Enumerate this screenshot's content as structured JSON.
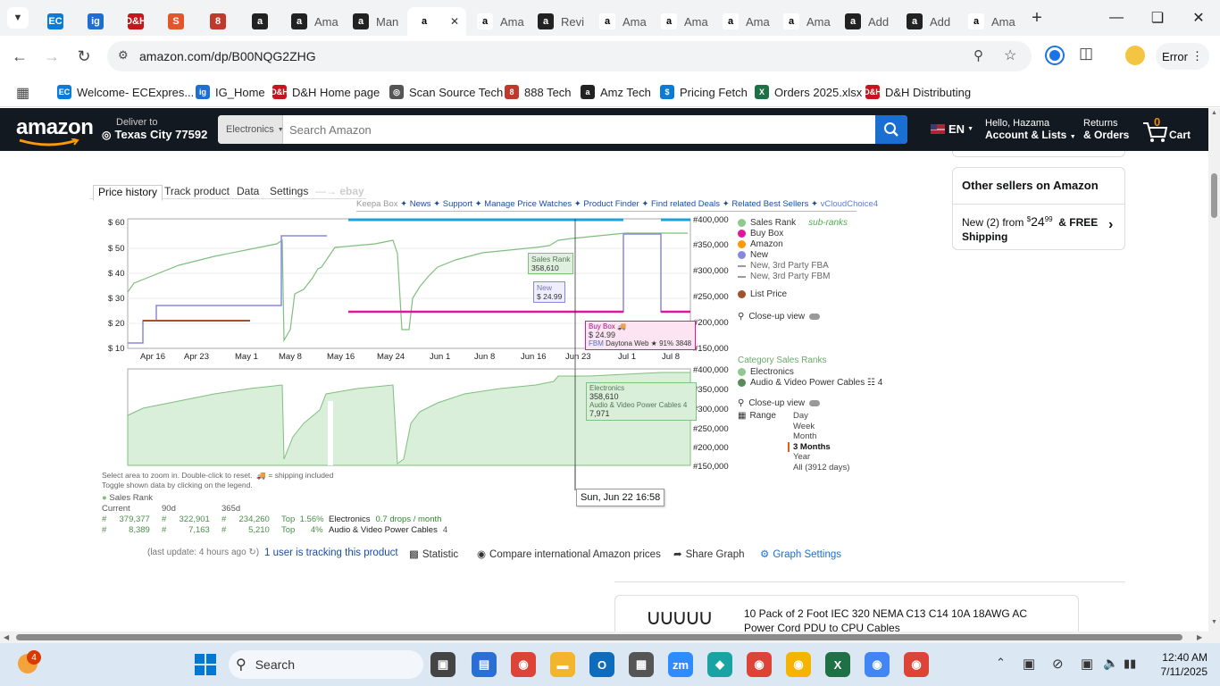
{
  "browser": {
    "tabs": [
      {
        "label": "",
        "icon": "ec-icon",
        "color": "#0a7bd6",
        "glyph": "EC"
      },
      {
        "label": "",
        "icon": "ig-icon",
        "color": "#1f6fd1",
        "glyph": "ig"
      },
      {
        "label": "",
        "icon": "dh-icon",
        "color": "#c4161c",
        "glyph": "D&H"
      },
      {
        "label": "",
        "icon": "scan-icon",
        "color": "#e2562b",
        "glyph": "S"
      },
      {
        "label": "",
        "icon": "888-icon",
        "color": "#c0392b",
        "glyph": "8"
      },
      {
        "label": "",
        "icon": "amz-tech-icon",
        "color": "#222",
        "glyph": "a"
      },
      {
        "label": "Ama",
        "icon": "amz-tech-icon",
        "color": "#222",
        "glyph": "a"
      },
      {
        "label": "Man",
        "icon": "amz-tech-icon",
        "color": "#222",
        "glyph": "a"
      },
      {
        "label": "",
        "icon": "amazon-icon",
        "color": "#ffffff",
        "glyph": "a",
        "active": true
      },
      {
        "label": "Ama",
        "icon": "amazon-icon",
        "color": "#ffffff",
        "glyph": "a"
      },
      {
        "label": "Revi",
        "icon": "amz-tech-icon",
        "color": "#222",
        "glyph": "a"
      },
      {
        "label": "Ama",
        "icon": "amazon-icon",
        "color": "#ffffff",
        "glyph": "a"
      },
      {
        "label": "Ama",
        "icon": "amazon-icon",
        "color": "#ffffff",
        "glyph": "a"
      },
      {
        "label": "Ama",
        "icon": "amazon-icon",
        "color": "#ffffff",
        "glyph": "a"
      },
      {
        "label": "Ama",
        "icon": "amazon-icon",
        "color": "#ffffff",
        "glyph": "a"
      },
      {
        "label": "Add",
        "icon": "amz-tech-icon",
        "color": "#222",
        "glyph": "a"
      },
      {
        "label": "Add",
        "icon": "amz-tech-icon",
        "color": "#222",
        "glyph": "a"
      },
      {
        "label": "Ama",
        "icon": "amazon-icon",
        "color": "#ffffff",
        "glyph": "a"
      }
    ],
    "url": "amazon.com/dp/B00NQG2ZHG",
    "profile_status": "Error",
    "bookmarks": [
      {
        "label": "Welcome- ECExpres...",
        "color": "#0a7bd6",
        "glyph": "EC"
      },
      {
        "label": "IG_Home",
        "color": "#1f6fd1",
        "glyph": "ig"
      },
      {
        "label": "D&H Home page",
        "color": "#c4161c",
        "glyph": "D&H"
      },
      {
        "label": "Scan Source Tech",
        "color": "#555",
        "glyph": "◎"
      },
      {
        "label": "888 Tech",
        "color": "#c0392b",
        "glyph": "8"
      },
      {
        "label": "Amz Tech",
        "color": "#222",
        "glyph": "a"
      },
      {
        "label": "Pricing Fetch",
        "color": "#0a7bd6",
        "glyph": "$"
      },
      {
        "label": "Orders 2025.xlsx",
        "color": "#1e7145",
        "glyph": "X"
      },
      {
        "label": "D&H Distributing",
        "color": "#c4161c",
        "glyph": "D&H"
      }
    ]
  },
  "amazon": {
    "logo": "amazon",
    "deliver_line1": "Deliver to",
    "deliver_line2": "Texas City 77592",
    "search_category": "Electronics",
    "search_placeholder": "Search Amazon",
    "lang": "EN",
    "hello": "Hello, Hazama",
    "account": "Account & Lists",
    "returns1": "Returns",
    "returns2": "& Orders",
    "cart_count": "0",
    "cart": "Cart"
  },
  "keepa": {
    "tabs": [
      "Price history",
      "Track product",
      "Data",
      "Settings",
      "ebay"
    ],
    "links": [
      "Keepa Box",
      "News",
      "Support",
      "Manage Price Watches",
      "Product Finder",
      "Find related Deals",
      "Related Best Sellers",
      "vCloudChoice4"
    ],
    "price_axis": [
      "$ 60",
      "$ 50",
      "$ 40",
      "$ 30",
      "$ 20",
      "$ 10"
    ],
    "rank_axis": [
      "#400,000",
      "#350,000",
      "#300,000",
      "#250,000",
      "#200,000",
      "#150,000"
    ],
    "rank_axis2": [
      "#400,000",
      "#350,000",
      "#300,000",
      "#250,000",
      "#200,000",
      "#150,000"
    ],
    "dates": [
      "Apr 16",
      "Apr 23",
      "May 1",
      "May 8",
      "May 16",
      "May 24",
      "Jun 1",
      "Jun 8",
      "Jun 16",
      "Jun 23",
      "Jul 1",
      "Jul 8"
    ],
    "legend": [
      {
        "label": "Sales Rank",
        "color": "#8fc98f",
        "extra": "sub-ranks"
      },
      {
        "label": "Buy Box",
        "color": "#e0169c"
      },
      {
        "label": "Amazon",
        "color": "#ff9900"
      },
      {
        "label": "New",
        "color": "#8888dd"
      },
      {
        "label": "New, 3rd Party FBA",
        "color": "#999999"
      },
      {
        "label": "New, 3rd Party FBM",
        "color": "#999999"
      },
      {
        "label": "List Price",
        "color": "#a0522d"
      }
    ],
    "closeup": "Close-up view",
    "category_title": "Category Sales Ranks",
    "cat_legend": [
      {
        "label": "Electronics",
        "color": "#8fc98f"
      },
      {
        "label": "Audio & Video Power Cables",
        "color": "#5a8a5a",
        "suffix": "4"
      }
    ],
    "closeup2": "Close-up view",
    "range_label": "Range",
    "ranges": [
      "Day",
      "Week",
      "Month",
      "3 Months",
      "Year",
      "All (3912 days)"
    ],
    "range_selected": "3 Months",
    "tooltip_rank": {
      "title": "Sales Rank",
      "value": "358,610"
    },
    "tooltip_new": {
      "title": "New",
      "value": "$ 24.99"
    },
    "tooltip_buybox": {
      "title": "Buy Box",
      "price": "$ 24.99",
      "tag": "FBM",
      "seller": "Daytona Web",
      "rating": "91%",
      "count": "3848"
    },
    "tooltip_cat": {
      "cat": "Electronics",
      "cat_val": "358,610",
      "sub": "Audio & Video Power Cables",
      "sub_suffix": "4",
      "sub_val": "7,971"
    },
    "cursor_time": "Sun, Jun 22 16:58",
    "hint1": "Select area to zoom in. Double-click to reset.",
    "hint1b": "= shipping included",
    "hint2": "Toggle shown data by clicking on the legend.",
    "stats_title": "Sales Rank",
    "stats_headers": [
      "Current",
      "90d",
      "365d"
    ],
    "stats_rows": [
      {
        "c": "379,377",
        "d90": "322,901",
        "d365": "234,260",
        "top": "1.56%",
        "cat": "Electronics",
        "drops": "0.7 drops / month"
      },
      {
        "c": "8,389",
        "d90": "7,163",
        "d365": "5,210",
        "top": "4%",
        "cat": "Audio & Video Power Cables",
        "drops": "4"
      }
    ],
    "last_update": "(last update: 4 hours ago",
    "tracking": "1 user is tracking this product",
    "statistic": "Statistic",
    "compare": "Compare international Amazon prices",
    "share": "Share Graph",
    "graph_settings": "Graph Settings"
  },
  "sellers": {
    "title": "Other sellers on Amazon",
    "offer_prefix": "New (2) from",
    "dollars": "24",
    "cents": "99",
    "free": "& FREE",
    "shipping": "Shipping"
  },
  "product_card": {
    "title": "10 Pack of 2 Foot IEC 320 NEMA C13 C14 10A 18AWG AC Power Cord PDU to CPU Cables"
  },
  "taskbar": {
    "notif_count": "4",
    "search": "Search",
    "time": "12:40 AM",
    "date": "7/11/2025"
  }
}
